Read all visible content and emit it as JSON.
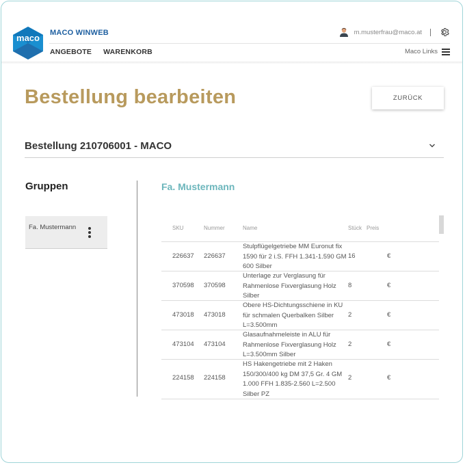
{
  "header": {
    "brand": "MACO WINWEB",
    "logo_text": "maco",
    "nav": [
      "ANGEBOTE",
      "WARENKORB"
    ],
    "user_email": "m.musterfrau@maco.at",
    "links_label": "Maco Links",
    "icons": [
      "user-icon",
      "gear-icon",
      "hamburger-icon"
    ]
  },
  "page": {
    "title": "Bestellung bearbeiten",
    "back_label": "ZURÜCK"
  },
  "order": {
    "title": "Bestellung 210706001 - MACO"
  },
  "groups": {
    "title": "Gruppen",
    "items": [
      {
        "label": "Fa. Mustermann"
      }
    ]
  },
  "company": {
    "title": "Fa. Mustermann"
  },
  "table": {
    "headers": {
      "sku": "SKU",
      "number": "Nummer",
      "name": "Name",
      "qty": "Stück",
      "price": "Preis"
    },
    "rows": [
      {
        "sku": "226637",
        "number": "226637",
        "name": "Stulpflügelgetriebe MM Euronut fix 1590 für 2 i.S. FFH 1.341-1.590 GM 600 Silber",
        "qty": "16",
        "price": "€"
      },
      {
        "sku": "370598",
        "number": "370598",
        "name": "Unterlage zur Verglasung für Rahmenlose Fixverglasung Holz Silber",
        "qty": "8",
        "price": "€"
      },
      {
        "sku": "473018",
        "number": "473018",
        "name": "Obere HS-Dichtungsschiene in KU für schmalen Querbalken Silber L=3.500mm",
        "qty": "2",
        "price": "€"
      },
      {
        "sku": "473104",
        "number": "473104",
        "name": "Glasaufnahmeleiste in ALU für Rahmenlose Fixverglasung Holz L=3.500mm Silber",
        "qty": "2",
        "price": "€"
      },
      {
        "sku": "224158",
        "number": "224158",
        "name": "HS Hakengetriebe mit 2 Haken 150/300/400 kg DM 37,5 Gr. 4 GM 1.000 FFH 1.835-2.560 L=2.500 Silber PZ",
        "qty": "2",
        "price": "€"
      }
    ]
  },
  "colors": {
    "title_gold": "#b89a5d",
    "company_teal": "#6cb6bc",
    "brand_blue": "#1e5fa0",
    "frame_border": "#9fd4d8"
  }
}
